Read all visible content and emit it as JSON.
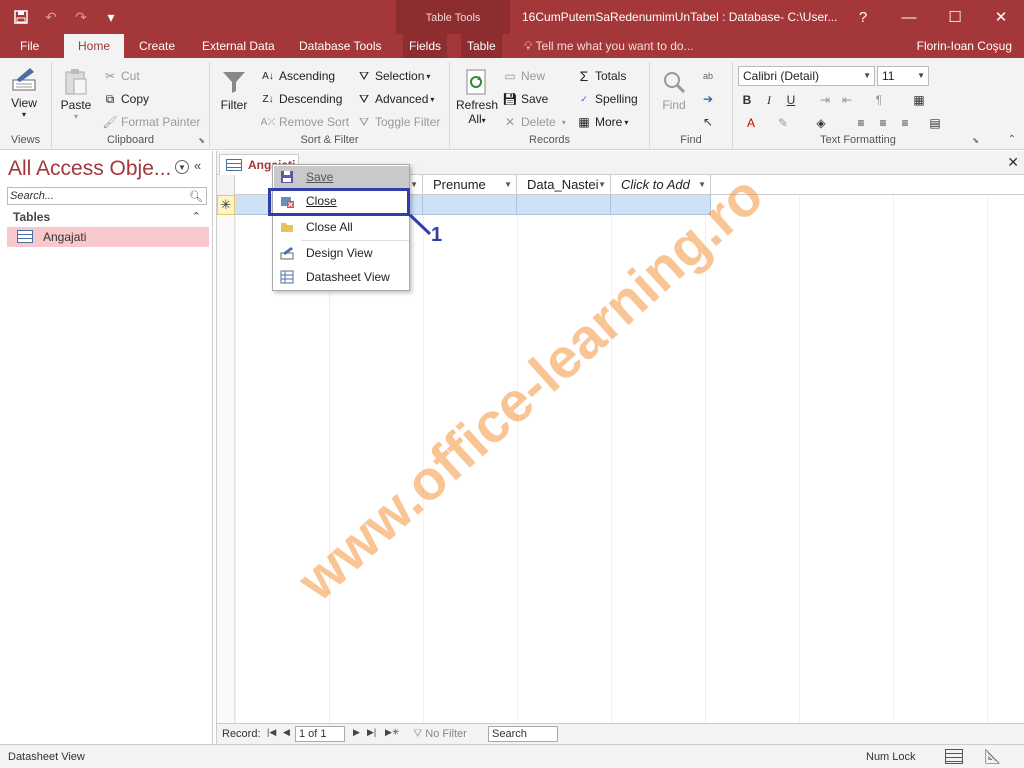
{
  "titlebar": {
    "contextual_group": "Table Tools",
    "document_title": "16CumPutemSaRedenumimUnTabel : Database- C:\\User...",
    "help": "?",
    "minimize": "—",
    "restore": "☐",
    "close": "✕"
  },
  "tabs": [
    {
      "label": "File"
    },
    {
      "label": "Home"
    },
    {
      "label": "Create"
    },
    {
      "label": "External Data"
    },
    {
      "label": "Database Tools"
    },
    {
      "label": "Fields"
    },
    {
      "label": "Table"
    }
  ],
  "tell_me": "Tell me what you want to do...",
  "user": "Florin-Ioan Coşug",
  "ribbon": {
    "views": {
      "label": "Views",
      "view": "View"
    },
    "clipboard": {
      "label": "Clipboard",
      "paste": "Paste",
      "cut": "Cut",
      "copy": "Copy",
      "format_painter": "Format Painter"
    },
    "sort_filter": {
      "label": "Sort & Filter",
      "filter": "Filter",
      "ascending": "Ascending",
      "descending": "Descending",
      "remove_sort": "Remove Sort",
      "selection": "Selection",
      "advanced": "Advanced",
      "toggle_filter": "Toggle Filter"
    },
    "records": {
      "label": "Records",
      "refresh": "Refresh",
      "refresh2": "All",
      "new": "New",
      "save": "Save",
      "delete": "Delete",
      "totals": "Totals",
      "spelling": "Spelling",
      "more": "More"
    },
    "find": {
      "label": "Find",
      "find": "Find"
    },
    "text_formatting": {
      "label": "Text Formatting",
      "font": "Calibri (Detail)",
      "size": "11"
    }
  },
  "nav": {
    "title": "All Access Obje...",
    "search_placeholder": "Search...",
    "group": "Tables",
    "items": [
      {
        "label": "Angajati"
      }
    ]
  },
  "document": {
    "tab_label": "Angajati",
    "columns": [
      {
        "label": "Prenume"
      },
      {
        "label": "Data_Nastei"
      },
      {
        "label": "Click to Add"
      }
    ],
    "new_row_marker": "✳"
  },
  "record_nav": {
    "label": "Record:",
    "position": "1 of 1",
    "filter": "No Filter",
    "search": "Search"
  },
  "context_menu": {
    "items": [
      {
        "label": "Save"
      },
      {
        "label": "Close"
      },
      {
        "label": "Close All"
      },
      {
        "label": "Design View"
      },
      {
        "label": "Datasheet View"
      }
    ]
  },
  "callout": {
    "number": "1"
  },
  "status": {
    "left": "Datasheet View",
    "numlock": "Num Lock"
  },
  "watermark": "www.office-learning.ro",
  "colors": {
    "accent": "#a4373a",
    "callout": "#2f3ea8",
    "watermark": "#f5963c",
    "selection_row": "#cfe1f5"
  }
}
